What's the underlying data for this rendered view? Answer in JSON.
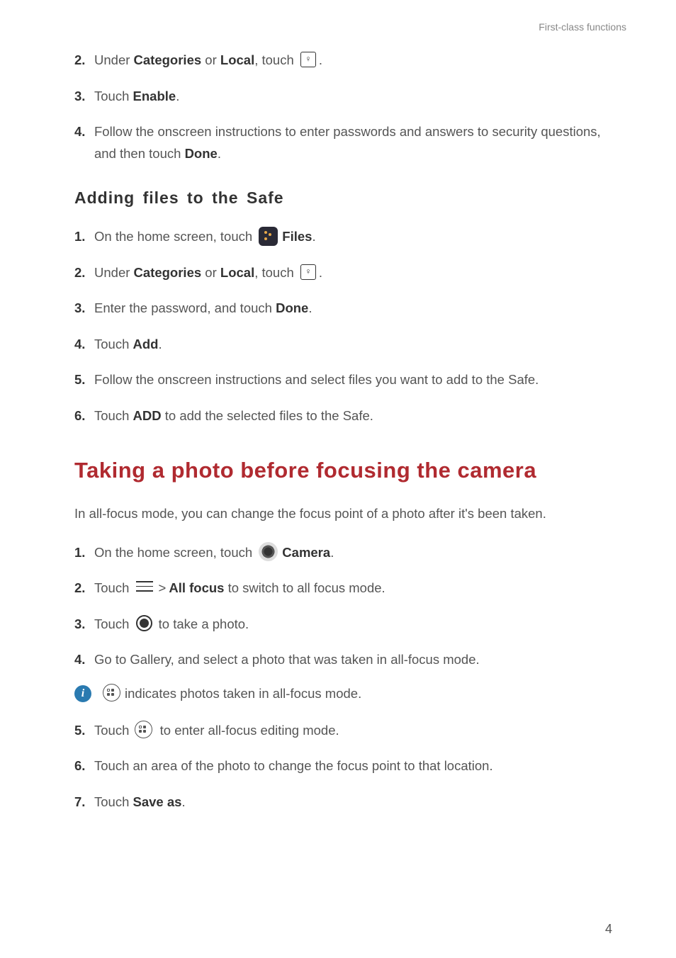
{
  "header": "First-class functions",
  "sec1": {
    "s2": {
      "num": "2.",
      "pre": "Under ",
      "b1": "Categories",
      "mid": " or ",
      "b2": "Local",
      "post": ", touch ",
      "end": "."
    },
    "s3": {
      "num": "3.",
      "pre": "Touch ",
      "b1": "Enable",
      "post": "."
    },
    "s4": {
      "num": "4.",
      "text_a": "Follow the onscreen instructions to enter passwords and answers to security questions, and then touch ",
      "b1": "Done",
      "post": "."
    }
  },
  "h3_adding": "Adding files to the Safe",
  "sec2": {
    "s1": {
      "num": "1.",
      "pre": "On the home screen, touch ",
      "b1": "Files",
      "post": "."
    },
    "s2": {
      "num": "2.",
      "pre": "Under ",
      "b1": "Categories",
      "mid": " or ",
      "b2": "Local",
      "post": ", touch ",
      "end": "."
    },
    "s3": {
      "num": "3.",
      "pre": "Enter the password, and touch ",
      "b1": "Done",
      "post": "."
    },
    "s4": {
      "num": "4.",
      "pre": "Touch ",
      "b1": "Add",
      "post": "."
    },
    "s5": {
      "num": "5.",
      "text": "Follow the onscreen instructions and select files you want to add to the Safe."
    },
    "s6": {
      "num": "6.",
      "pre": "Touch ",
      "b1": "ADD",
      "post": " to add the selected files to the Safe."
    }
  },
  "h2_photo": "Taking a photo before focusing the camera",
  "photo_intro": "In all-focus mode, you can change the focus point of a photo after it's been taken.",
  "sec3": {
    "s1": {
      "num": "1.",
      "pre": "On the home screen, touch ",
      "b1": "Camera",
      "post": "."
    },
    "s2": {
      "num": "2.",
      "pre": "Touch ",
      "gt": ">",
      "b1": "All focus",
      "post": " to switch to all focus mode."
    },
    "s3": {
      "num": "3.",
      "pre": "Touch ",
      "post": " to take a photo."
    },
    "s4": {
      "num": "4.",
      "text": "Go to Gallery, and select a photo that was taken in all-focus mode."
    },
    "info": {
      "text": " indicates photos taken in all-focus mode."
    },
    "s5": {
      "num": "5.",
      "pre": "Touch ",
      "post": " to enter all-focus editing mode."
    },
    "s6": {
      "num": "6.",
      "text": "Touch an area of the photo to change the focus point to that location."
    },
    "s7": {
      "num": "7.",
      "pre": "Touch ",
      "b1": "Save as",
      "post": "."
    }
  },
  "page_number": "4"
}
